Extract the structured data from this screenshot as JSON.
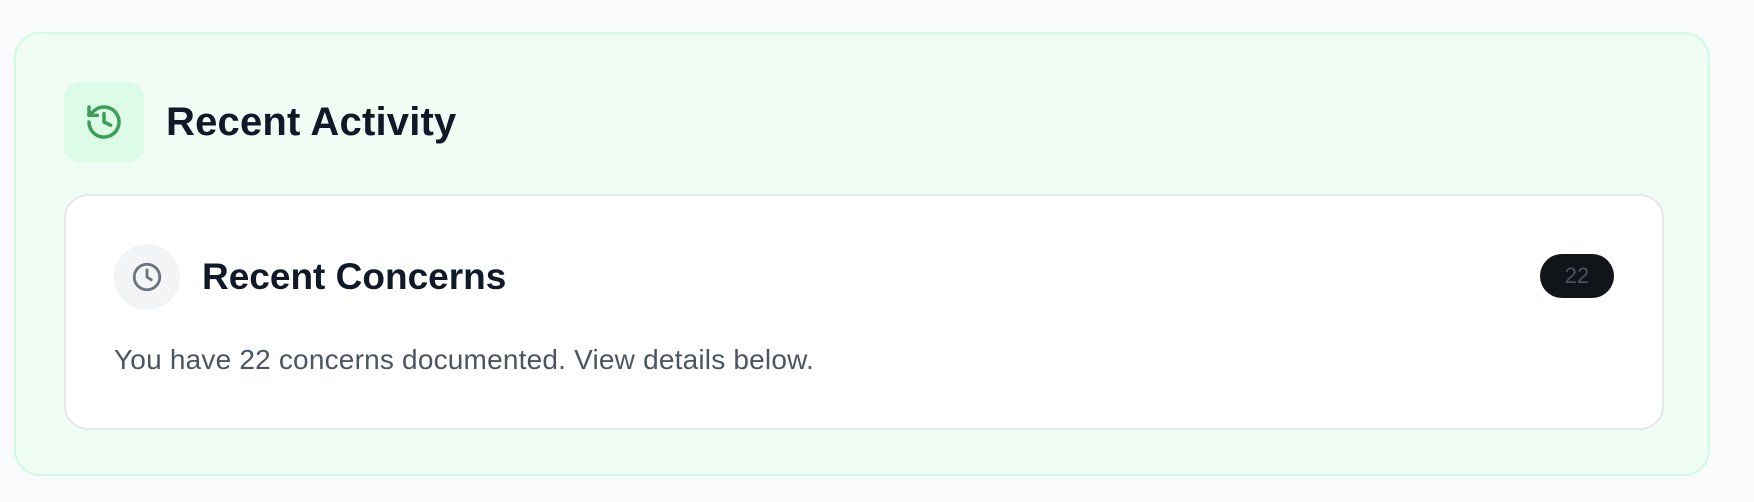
{
  "activity": {
    "title": "Recent Activity",
    "icon": "history-icon",
    "accent_color": "#16a34a"
  },
  "concerns": {
    "title": "Recent Concerns",
    "icon": "clock-icon",
    "count": "22",
    "description": "You have 22 concerns documented. View details below."
  },
  "colors": {
    "card_bg": "#f0fdf4",
    "card_border": "#d1fae5",
    "badge_bg": "#111418",
    "text_muted": "#4b5563"
  }
}
